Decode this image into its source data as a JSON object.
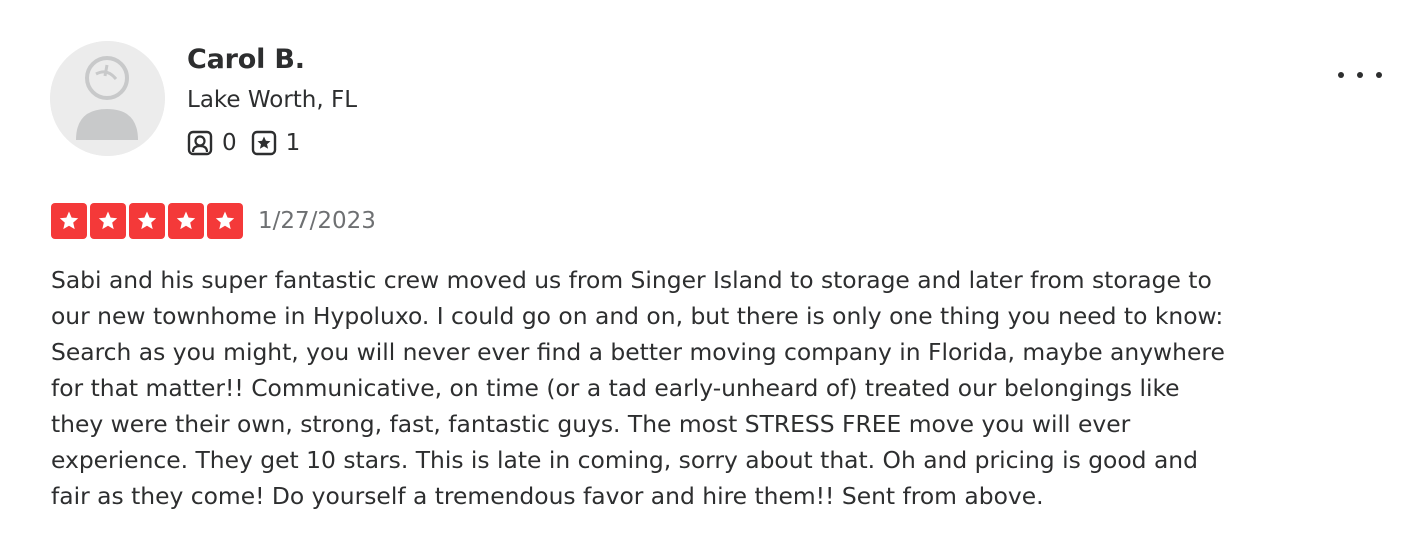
{
  "reviewer": {
    "name": "Carol B.",
    "location": "Lake Worth, FL",
    "avatar_icon": "default-user-avatar",
    "stats": {
      "friends_icon": "friends-icon",
      "friends_count": "0",
      "reviews_icon": "reviews-icon",
      "reviews_count": "1"
    }
  },
  "menu": {
    "more_icon": "more-options-icon"
  },
  "review": {
    "rating": 5,
    "rating_max": 5,
    "star_color": "#f43939",
    "date": "1/27/2023",
    "text": "Sabi and his super fantastic crew moved us from Singer Island to storage and later from storage to our new townhome in Hypoluxo. I could go on and on, but there is only one thing you need to know: Search as you might, you will never ever find a better moving company in Florida, maybe anywhere for that matter!! Communicative, on time (or a tad early-unheard of) treated our belongings like they were their own, strong, fast, fantastic guys. The most STRESS FREE move you will ever experience. They get 10 stars. This is late in coming, sorry about that. Oh and pricing is good and fair as they come! Do yourself a tremendous favor and hire them!! Sent from above."
  }
}
